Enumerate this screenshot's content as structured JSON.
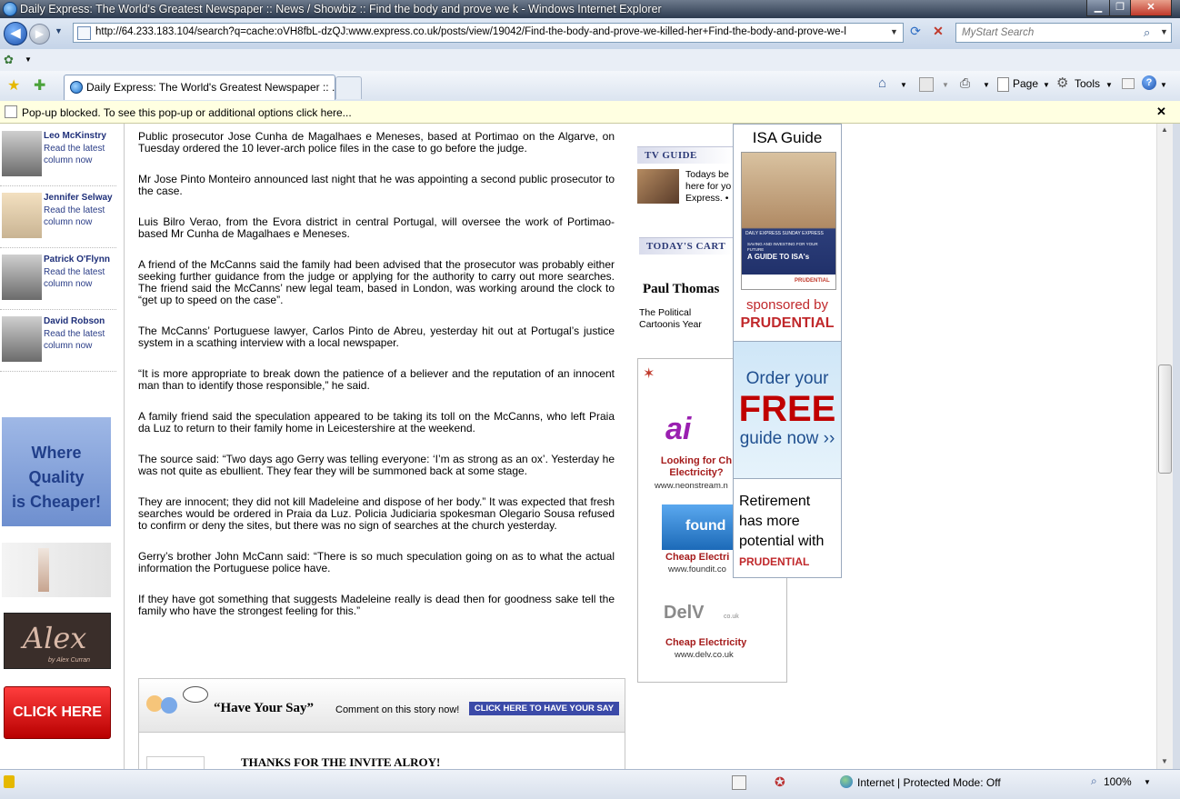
{
  "window": {
    "title": "Daily Express: The World's Greatest Newspaper :: News / Showbiz :: Find the body and prove we k - Windows Internet Explorer"
  },
  "nav": {
    "url": "http://64.233.183.104/search?q=cache:oVH8fbL-dzQJ:www.express.co.uk/posts/view/19042/Find-the-body-and-prove-we-killed-her+Find-the-body-and-prove-we-l",
    "search_placeholder": "MyStart Search"
  },
  "tabs": [
    {
      "label": "Daily Express: The World's Greatest Newspaper :: ..."
    }
  ],
  "toolbar": {
    "page_label": "Page",
    "tools_label": "Tools"
  },
  "popup": {
    "message": "Pop-up blocked. To see this pop-up or additional options click here...",
    "close": "✕"
  },
  "columnists": [
    {
      "name": "Leo McKinstry",
      "link": "Read the latest column now"
    },
    {
      "name": "Jennifer Selway",
      "link": "Read the latest column now"
    },
    {
      "name": "Patrick O'Flynn",
      "link": "Read the latest column now"
    },
    {
      "name": "David Robson",
      "link": "Read the latest column now"
    }
  ],
  "left_ads": {
    "quality": [
      "Where",
      "Quality",
      "is Cheaper!"
    ],
    "alex_script": "Alex",
    "alex_sub": "by Alex Curran",
    "click_here": "CLICK HERE"
  },
  "article": {
    "paragraphs": [
      "Public prosecutor Jose Cunha de Magalhaes e Meneses, based at Portimao on the Algarve, on Tuesday ordered the 10 lever-arch police files in the case to go before the judge.",
      "Mr Jose Pinto Monteiro announced last night that he was appointing a second public prosecutor to the case.",
      " Luis Bilro Verao, from the Evora district in central Portugal, will oversee the work of Portimao-based Mr Cunha de Magalhaes e Meneses.",
      "A friend of the McCanns said the family had been advised that the prosecutor was probably either seeking further guidance from the judge or applying for the authority to carry out more searches. The friend said the McCanns’ new legal team, based in London, was working around the clock to “get up to speed on the case”.",
      "The McCanns’ Portuguese lawyer, Carlos Pinto de Abreu, yesterday hit out at Portugal’s justice system in a scathing interview with a local newspaper.",
      "“It is more appropriate to break down the patience of a believer and the reputation of an innocent man than to identify those responsible,” he said.",
      "A family friend said the speculation appeared to be taking its toll on the McCanns, who left Praia da Luz to return to their family home in Leicestershire at the weekend.",
      "The source said: “Two days ago Gerry was telling everyone: ‘I’m as strong as an ox’. Yesterday he was not quite as ebullient. They fear they will be summoned back at some stage.",
      "They are innocent; they did not kill Madeleine and dispose of her body.” It was expected that fresh searches would be ordered in Praia da Luz. Policia Judiciaria spokesman Olegario Sousa refused to confirm or deny the sites, but there was no sign of searches at the church yesterday.",
      " Gerry’s brother John McCann said: “There is so much speculation going on as to what the actual information the Portuguese police have.",
      "If they have got something that suggests Madeleine really is dead then for goodness sake tell the family who have the strongest feeling for this.”"
    ]
  },
  "have_your_say": {
    "title": "“Have Your Say”",
    "prompt": "Comment on this story now!",
    "button": "CLICK HERE TO HAVE YOUR SAY",
    "first_comment": "THANKS FOR THE INVITE ALROY!"
  },
  "right": {
    "tv_guide": {
      "heading": "TV GUIDE",
      "text": "Todays be here for yo Express. •"
    },
    "cartoon": {
      "heading": "TODAY'S CART",
      "author": "Paul Thomas",
      "caption": "The Political Cartoonis Year"
    },
    "ads": [
      {
        "title": "Looking for Ch Electricity?",
        "url": "www.neonstream.n"
      },
      {
        "title": "Cheap Electri",
        "url": "www.foundit.co"
      },
      {
        "title": "Cheap Electricity",
        "url": "www.delv.co.uk"
      }
    ],
    "logos": {
      "neon": "ai",
      "found": "found",
      "delv": "DelV",
      "delv_sub": "co.uk"
    }
  },
  "float_ad": {
    "isa_title": "ISA Guide",
    "cover_papers": "DAILY EXPRESS   SUNDAY EXPRESS",
    "cover_small": "SAVING AND INVESTING FOR YOUR FUTURE",
    "cover_title": "A GUIDE TO ISA's",
    "cover_brand": "PRUDENTIAL",
    "sponsored": "sponsored by",
    "brand": "PRUDENTIAL",
    "order": "Order your",
    "free": "FREE",
    "guide": "guide now ››",
    "retire": [
      "Retirement",
      "has more",
      "potential with"
    ],
    "retire_brand": "PRUDENTIAL"
  },
  "status": {
    "zone": "Internet | Protected Mode: Off",
    "zoom": "100%"
  }
}
